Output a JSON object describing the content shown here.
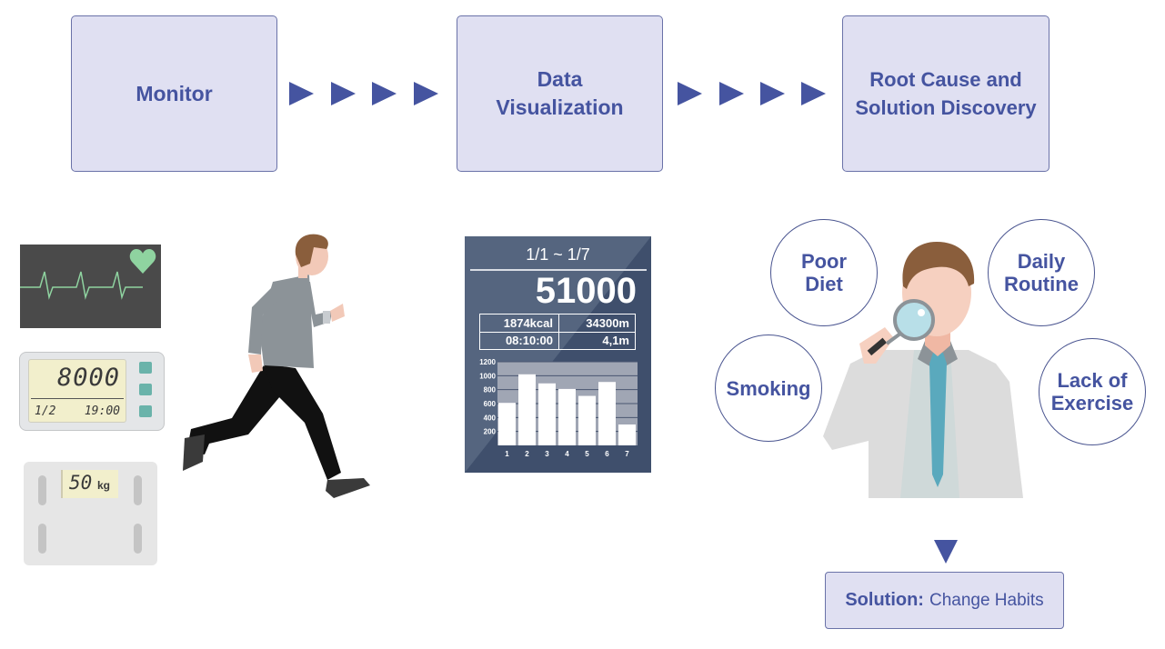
{
  "stages": [
    {
      "label": "Monitor"
    },
    {
      "label": "Data Visualization",
      "lines": [
        "Data",
        "Visualization"
      ]
    },
    {
      "label": "Root Cause and Solution Discovery",
      "lines": [
        "Root Cause and",
        "Solution Discovery"
      ]
    }
  ],
  "flow_arrows": {
    "per_connector": 4,
    "icon": "triangle-right-icon"
  },
  "colors": {
    "accent": "#4554a0",
    "box_fill": "#e0e0f2",
    "box_border": "#6a72a8",
    "dashboard_bg": "#55657f",
    "heart": "#8fd3a0",
    "tie": "#5aa9bd",
    "lcd": "#f2efcc"
  },
  "monitor_devices": {
    "heart_monitor": {
      "icon": "heart-icon"
    },
    "pedometer": {
      "steps": "8000",
      "date": "1/2",
      "time": "19:00"
    },
    "scale": {
      "weight": "50",
      "unit": "kg"
    }
  },
  "dashboard": {
    "date_range": "1/1 ~ 1/7",
    "total": "51000",
    "stats": [
      {
        "value": "1874kcal"
      },
      {
        "value": "34300m"
      },
      {
        "value": "08:10:00"
      },
      {
        "value": "4,1m"
      }
    ]
  },
  "chart_data": {
    "type": "bar",
    "title": "",
    "xlabel": "",
    "ylabel": "",
    "categories": [
      "1",
      "2",
      "3",
      "4",
      "5",
      "6",
      "7"
    ],
    "values": [
      610,
      1020,
      890,
      810,
      710,
      910,
      300
    ],
    "yticks": [
      "200",
      "400",
      "600",
      "800",
      "1000",
      "1200"
    ],
    "ylim": [
      0,
      1200
    ],
    "grid": true
  },
  "causes": [
    {
      "label": "Poor Diet",
      "lines": [
        "Poor",
        "Diet"
      ]
    },
    {
      "label": "Daily Routine",
      "lines": [
        "Daily",
        "Routine"
      ]
    },
    {
      "label": "Smoking",
      "lines": [
        "Smoking"
      ]
    },
    {
      "label": "Lack of Exercise",
      "lines": [
        "Lack of",
        "Exercise"
      ]
    }
  ],
  "solution": {
    "prefix": "Solution:",
    "text": "Change Habits"
  }
}
